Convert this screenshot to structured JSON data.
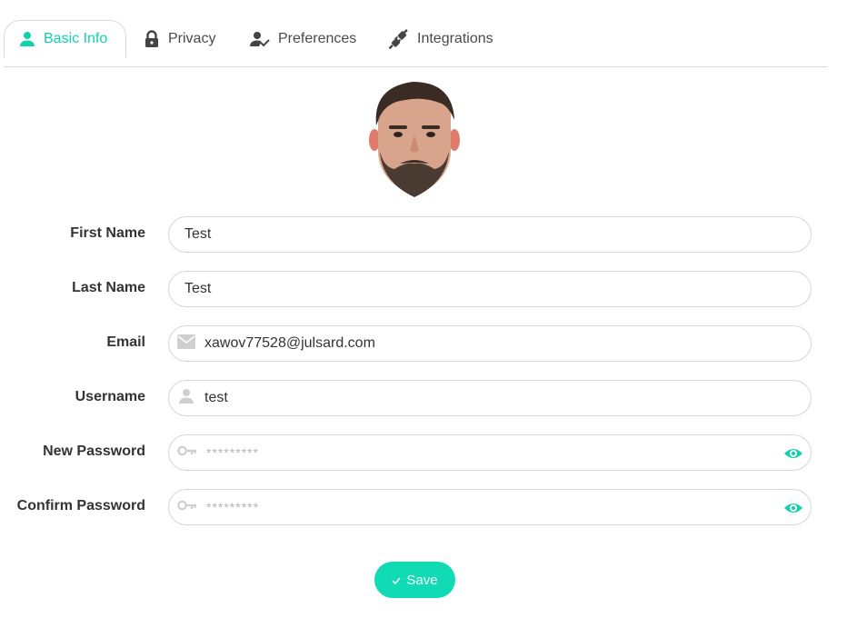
{
  "tabs": [
    {
      "label": "Basic Info",
      "icon": "user-icon",
      "active": true
    },
    {
      "label": "Privacy",
      "icon": "lock-icon",
      "active": false
    },
    {
      "label": "Preferences",
      "icon": "user-check-icon",
      "active": false
    },
    {
      "label": "Integrations",
      "icon": "plug-icon",
      "active": false
    }
  ],
  "form": {
    "first_name": {
      "label": "First Name",
      "value": "Test"
    },
    "last_name": {
      "label": "Last Name",
      "value": "Test"
    },
    "email": {
      "label": "Email",
      "value": "xawov77528@julsard.com",
      "icon": "envelope-icon"
    },
    "username": {
      "label": "Username",
      "value": "test",
      "icon": "user-icon"
    },
    "new_password": {
      "label": "New Password",
      "value": "*********",
      "icon": "key-icon"
    },
    "confirm_password": {
      "label": "Confirm Password",
      "value": "*********",
      "icon": "key-icon"
    }
  },
  "save_button": {
    "label": "Save",
    "icon": "check-icon"
  },
  "colors": {
    "accent": "#11d1ad",
    "button": "#11dbb4",
    "muted_icon": "#cfcfcf",
    "border": "#d6d6d6"
  }
}
